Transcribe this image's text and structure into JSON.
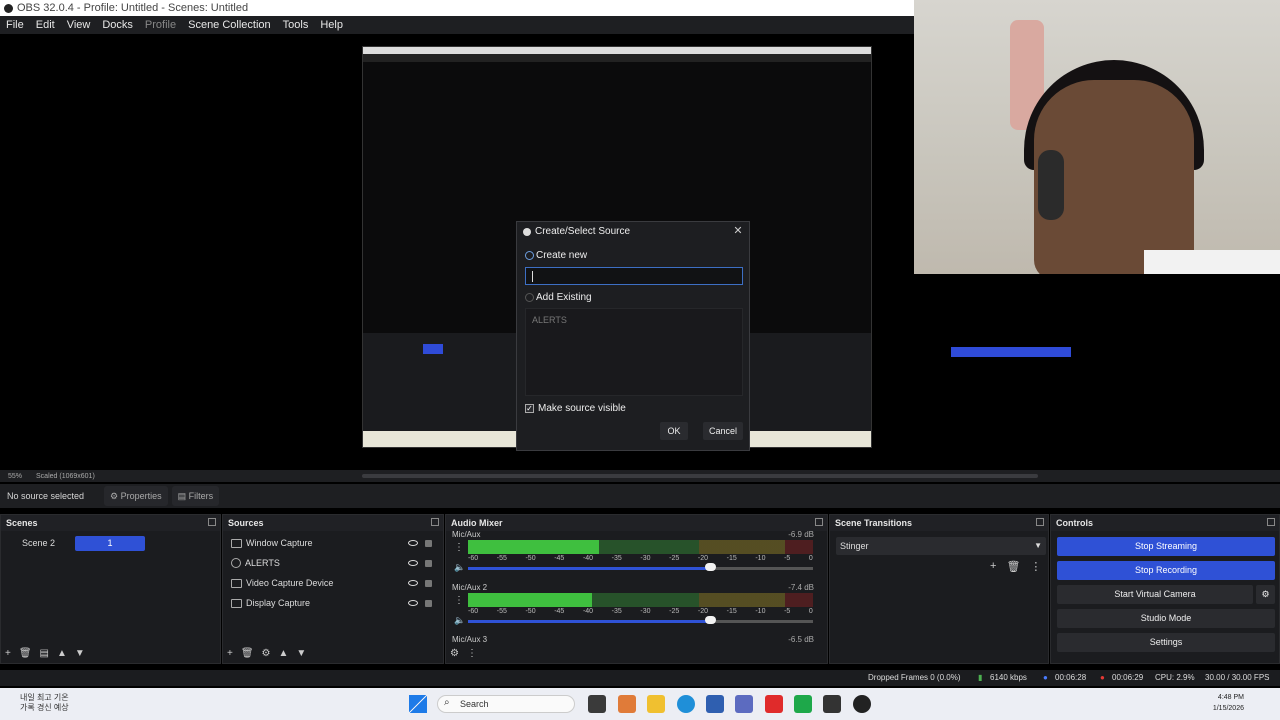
{
  "window": {
    "title": "OBS 32.0.4 - Profile: Untitled - Scenes: Untitled"
  },
  "menu": [
    "File",
    "Edit",
    "View",
    "Docks",
    "Profile",
    "Scene Collection",
    "Tools",
    "Help"
  ],
  "dialog": {
    "title": "Create/Select Source",
    "create_new_label": "Create new",
    "name_value": "",
    "add_existing_label": "Add Existing",
    "existing_items": [
      "ALERTS"
    ],
    "make_visible_label": "Make source visible",
    "make_visible_checked": true,
    "ok_label": "OK",
    "cancel_label": "Cancel"
  },
  "preview_bar": {
    "zoom": "55%",
    "scaled": "Scaled (1069x601)"
  },
  "info": {
    "no_source": "No source selected",
    "properties": "Properties",
    "filters": "Filters"
  },
  "scenes": {
    "title": "Scenes",
    "items": [
      {
        "label": "Scene 2",
        "badge": "1"
      }
    ]
  },
  "sources": {
    "title": "Sources",
    "items": [
      "Window Capture",
      "ALERTS",
      "Video Capture Device",
      "Display Capture"
    ]
  },
  "audio_mixer": {
    "title": "Audio Mixer",
    "channels": [
      {
        "name": "Mic/Aux",
        "db": "-6.9 dB",
        "level": 0.38,
        "volume": 0.7
      },
      {
        "name": "Mic/Aux 2",
        "db": "-7.4 dB",
        "level": 0.36,
        "volume": 0.7
      },
      {
        "name": "Mic/Aux 3",
        "db": "-6.5 dB"
      }
    ],
    "scale": [
      "-60",
      "-55",
      "-50",
      "-45",
      "-40",
      "-35",
      "-30",
      "-25",
      "-20",
      "-15",
      "-10",
      "-5",
      "0"
    ]
  },
  "transitions": {
    "title": "Scene Transitions",
    "selected": "Stinger"
  },
  "controls": {
    "title": "Controls",
    "buttons": [
      "Stop Streaming",
      "Stop Recording",
      "Start Virtual Camera",
      "Studio Mode",
      "Settings"
    ]
  },
  "status": {
    "dropped": "Dropped Frames 0 (0.0%)",
    "bitrate": "6140 kbps",
    "stream_time": "00:06:28",
    "rec_time": "00:06:29",
    "cpu": "CPU: 2.9%",
    "fps": "30.00 / 30.00 FPS"
  },
  "taskbar": {
    "news_line1": "내일 최고 기온",
    "news_line2": "가록 경신 예상",
    "search": "Search",
    "time": "4:48 PM",
    "date": "1/15/2026"
  },
  "colors": {
    "accent": "#2f51d6",
    "green": "#3fbf3f",
    "yellow": "#c9b02a",
    "red": "#b52323"
  }
}
